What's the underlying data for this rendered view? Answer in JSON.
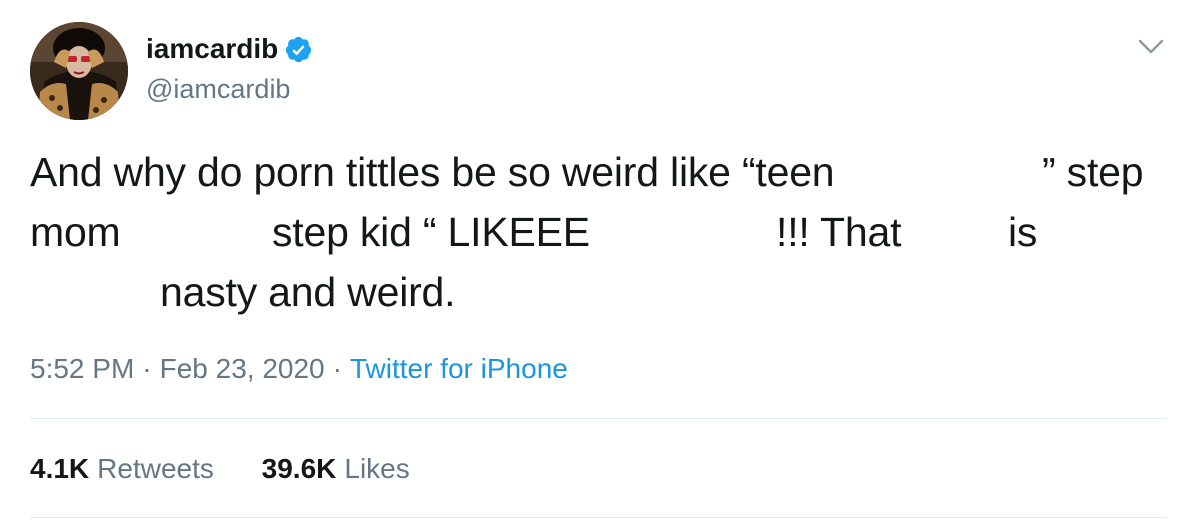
{
  "user": {
    "display_name": "iamcardib",
    "handle": "@iamcardib",
    "verified": true,
    "verified_color": "#1da1f2"
  },
  "icons": {
    "verified": "verified-badge-icon",
    "caret": "chevron-down-icon"
  },
  "tweet": {
    "line1": [
      "And why do porn tittles be so weird like “teen",
      "” step"
    ],
    "line2": [
      "mom",
      "step kid “ LIKEEE",
      "!!! That",
      "is"
    ],
    "line3": [
      "nasty and weird."
    ]
  },
  "meta": {
    "time": "5:52 PM",
    "separator": "·",
    "date": "Feb 23, 2020",
    "source": "Twitter for iPhone"
  },
  "stats": {
    "retweets_count": "4.1K",
    "retweets_label": "Retweets",
    "likes_count": "39.6K",
    "likes_label": "Likes"
  },
  "colors": {
    "link": "#1b95e0",
    "secondary_text": "#657786",
    "divider": "#e1e8ed"
  }
}
